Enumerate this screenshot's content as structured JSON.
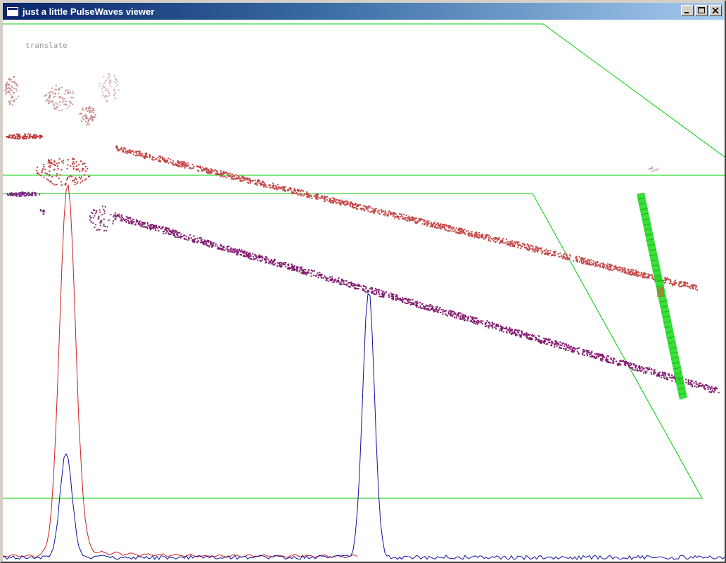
{
  "window": {
    "title": "just a little PulseWaves viewer"
  },
  "viewer": {
    "mode_label": "translate"
  },
  "colors": {
    "bounding_box": "#00cc00",
    "returns_upper": "#c44848",
    "returns_lower": "#801a6e",
    "highlight_pulse": "#22dd22",
    "waveform_outgoing": "#cc2020",
    "waveform_return": "#1010a0"
  },
  "icons": [
    "app-window-icon",
    "minimize-icon",
    "maximize-icon",
    "close-icon"
  ]
}
